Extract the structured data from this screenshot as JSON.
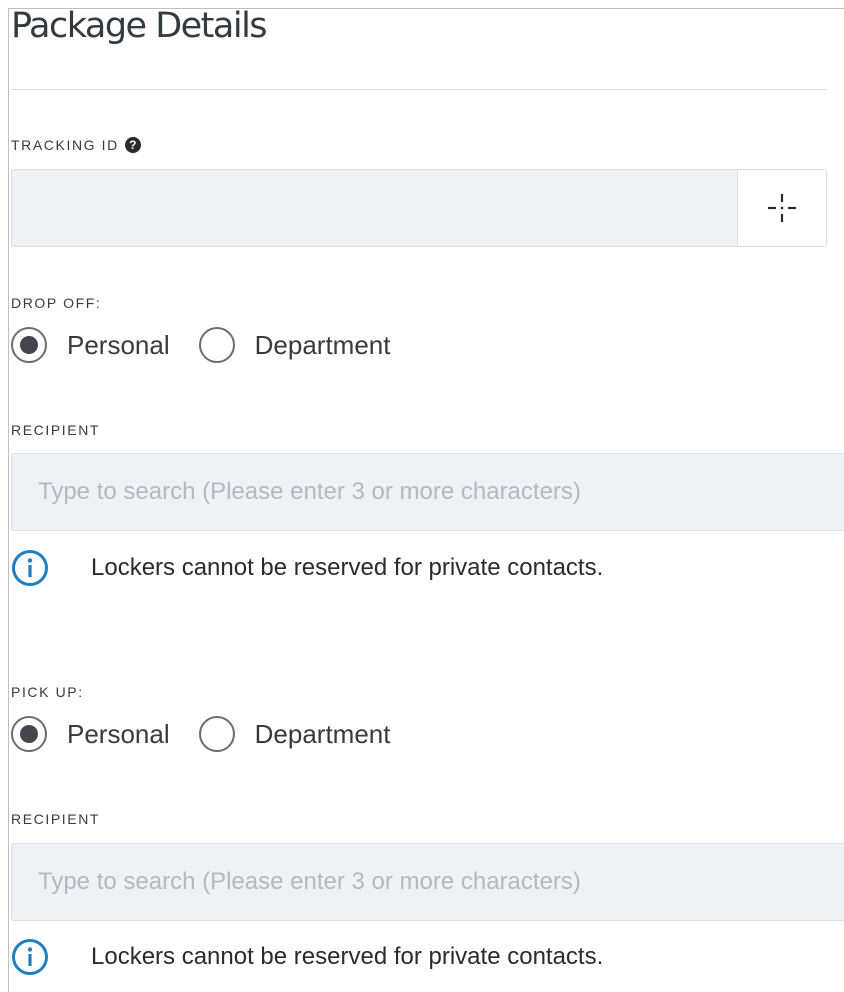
{
  "page": {
    "title": "Package Details"
  },
  "tracking": {
    "label": "TRACKING ID",
    "help_icon": "question-circle-icon",
    "help_glyph": "?",
    "value": "",
    "scan_icon": "crosshair-scan-icon"
  },
  "drop_off": {
    "label": "DROP OFF:",
    "options": [
      {
        "label": "Personal",
        "selected": true
      },
      {
        "label": "Department",
        "selected": false
      }
    ],
    "recipient": {
      "label": "RECIPIENT",
      "value": "",
      "placeholder": "Type to search (Please enter 3 or more characters)"
    },
    "notice": {
      "icon": "info-circle-icon",
      "text": "Lockers cannot be reserved for private contacts."
    }
  },
  "pick_up": {
    "label": "PICK UP:",
    "options": [
      {
        "label": "Personal",
        "selected": true
      },
      {
        "label": "Department",
        "selected": false
      }
    ],
    "recipient": {
      "label": "RECIPIENT",
      "value": "",
      "placeholder": "Type to search (Please enter 3 or more characters)"
    },
    "notice": {
      "icon": "info-circle-icon",
      "text": "Lockers cannot be reserved for private contacts."
    }
  },
  "colors": {
    "input_bg": "#eff1f4",
    "input_border": "#dcdfe3",
    "info_blue": "#1f7ec1",
    "radio_dot": "#44464d"
  }
}
